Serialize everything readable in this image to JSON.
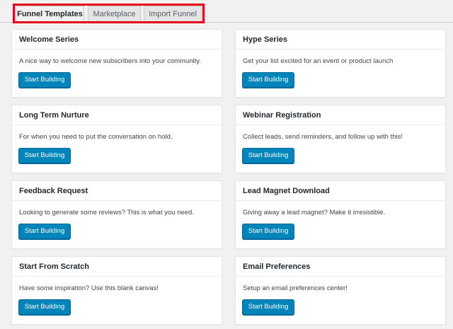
{
  "tabs": [
    {
      "label": "Funnel Templates",
      "active": true
    },
    {
      "label": "Marketplace",
      "active": false
    },
    {
      "label": "Import Funnel",
      "active": false
    }
  ],
  "cards": [
    {
      "title": "Welcome Series",
      "description": "A nice way to welcome new subscribers into your community.",
      "button": "Start Building"
    },
    {
      "title": "Hype Series",
      "description": "Get your list excited for an event or product launch",
      "button": "Start Building"
    },
    {
      "title": "Long Term Nurture",
      "description": "For when you need to put the conversation on hold.",
      "button": "Start Building"
    },
    {
      "title": "Webinar Registration",
      "description": "Collect leads, send reminders, and follow up with this!",
      "button": "Start Building"
    },
    {
      "title": "Feedback Request",
      "description": "Looking to generate some reviews? This is what you need.",
      "button": "Start Building"
    },
    {
      "title": "Lead Magnet Download",
      "description": "Giving away a lead magnet? Make it irresistible.",
      "button": "Start Building"
    },
    {
      "title": "Start From Scratch",
      "description": "Have some inspiration? Use this blank canvas!",
      "button": "Start Building"
    },
    {
      "title": "Email Preferences",
      "description": "Setup an email preferences center!",
      "button": "Start Building"
    }
  ],
  "colors": {
    "primary_button": "#0085ba",
    "highlight": "#e4001b",
    "background": "#f1f1f1"
  }
}
